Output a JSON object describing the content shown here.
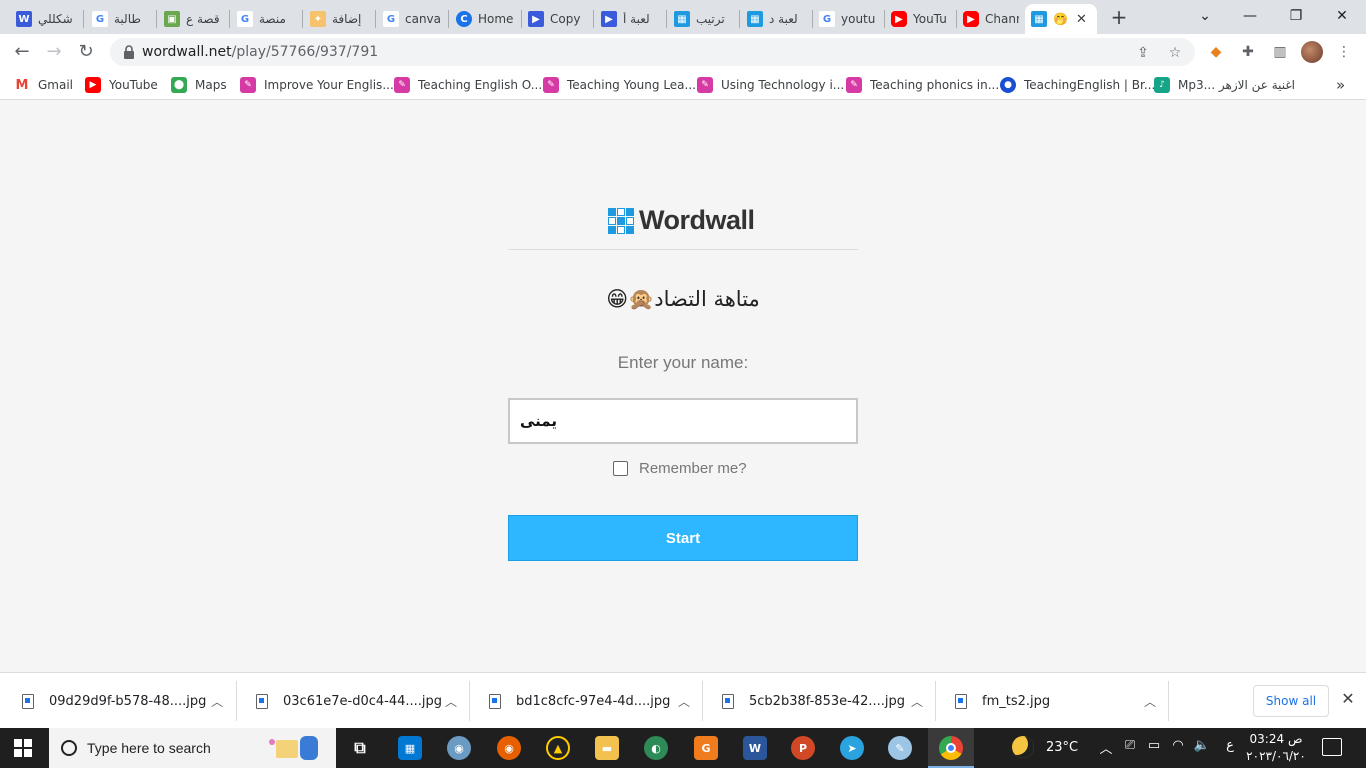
{
  "browser": {
    "tabs": [
      {
        "title": "شكللي",
        "favicon": "w-logo-icon",
        "color": "#3b5bdb"
      },
      {
        "title": "طالبة",
        "favicon": "google-icon",
        "color": "#4285f4"
      },
      {
        "title": "قصة ع",
        "favicon": "story-icon",
        "color": "#6aa84f"
      },
      {
        "title": "منصة",
        "favicon": "google-icon",
        "color": "#4285f4"
      },
      {
        "title": "إضافة",
        "favicon": "addon-icon",
        "color": "#f0a040"
      },
      {
        "title": "canva",
        "favicon": "google-icon",
        "color": "#4285f4"
      },
      {
        "title": "Home",
        "favicon": "canva-icon",
        "color": "#1a73e8"
      },
      {
        "title": "Copy",
        "favicon": "video-icon",
        "color": "#3b5bdb"
      },
      {
        "title": "لعبة أ",
        "favicon": "video-icon",
        "color": "#3b5bdb"
      },
      {
        "title": "ترتيب",
        "favicon": "wordwall-icon",
        "color": "#1d9ae0"
      },
      {
        "title": "لعبة د",
        "favicon": "wordwall-icon",
        "color": "#1d9ae0"
      },
      {
        "title": "youtu",
        "favicon": "google-icon",
        "color": "#4285f4"
      },
      {
        "title": "YouTu",
        "favicon": "youtube-icon",
        "color": "#ff0000"
      },
      {
        "title": "Chann",
        "favicon": "youtube-icon",
        "color": "#ff0000"
      },
      {
        "title": "🤭",
        "favicon": "wordwall-icon",
        "color": "#1d9ae0"
      }
    ],
    "address": {
      "domain": "wordwall.net",
      "path": "/play/57766/937/791"
    },
    "bookmarks": [
      {
        "label": "Gmail",
        "favicon": "gmail-icon",
        "color": "#ea4335"
      },
      {
        "label": "YouTube",
        "favicon": "youtube-icon",
        "color": "#ff0000"
      },
      {
        "label": "Maps",
        "favicon": "maps-icon",
        "color": "#34a853"
      },
      {
        "label": "Improve Your Englis...",
        "favicon": "teaching-icon",
        "color": "#d63ba5"
      },
      {
        "label": "Teaching English O...",
        "favicon": "teaching-icon",
        "color": "#d63ba5"
      },
      {
        "label": "Teaching Young Lea...",
        "favicon": "teaching-icon",
        "color": "#d63ba5"
      },
      {
        "label": "Using Technology i...",
        "favicon": "teaching-icon",
        "color": "#d63ba5"
      },
      {
        "label": "Teaching phonics in...",
        "favicon": "teaching-icon",
        "color": "#d63ba5"
      },
      {
        "label": "TeachingEnglish | Br...",
        "favicon": "british-council-icon",
        "color": "#1a4fd1"
      },
      {
        "label": "Mp3... اغنية عن الازهر",
        "favicon": "music-icon",
        "color": "#17a589"
      }
    ],
    "more_bookmarks": "»"
  },
  "page": {
    "logo_text": "Wordwall",
    "activity_title": "متاهة التضاد🙊😁",
    "name_label": "Enter your name:",
    "name_value": "يمنى",
    "remember_label": "Remember me?",
    "start_label": "Start"
  },
  "downloads": {
    "files": [
      {
        "name": "09d29d9f-b578-48....jpg"
      },
      {
        "name": "03c61e7e-d0c4-44....jpg"
      },
      {
        "name": "bd1c8cfc-97e4-4d....jpg"
      },
      {
        "name": "5cb2b38f-853e-42....jpg"
      },
      {
        "name": "fm_ts2.jpg"
      }
    ],
    "show_all": "Show all"
  },
  "taskbar": {
    "search_placeholder": "Type here to search",
    "temperature": "23°C",
    "lang": "ع",
    "time": "03:24 ص",
    "date": "٢٠٢٣/٠٦/٢٠"
  }
}
